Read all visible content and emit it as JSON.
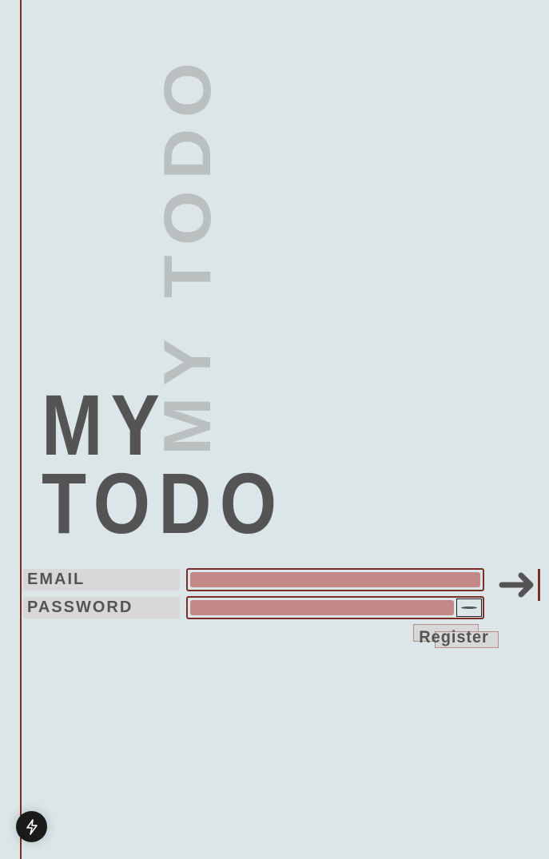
{
  "title": {
    "vertical": "MY TODO",
    "line1": "MY",
    "line2": "TODO"
  },
  "form": {
    "email_label": "EMAIL",
    "password_label": "PASSWORD",
    "email_value": "",
    "password_value": "",
    "register_label": "Register"
  },
  "icons": {
    "submit": "arrow-right-to-bar-icon",
    "toggle_password": "eye-icon",
    "dev_tools": "lightning-bolt-icon"
  },
  "colors": {
    "background": "#dce6e8",
    "accent": "#7a2e25",
    "input_fill": "#c48887",
    "text": "#545454"
  }
}
